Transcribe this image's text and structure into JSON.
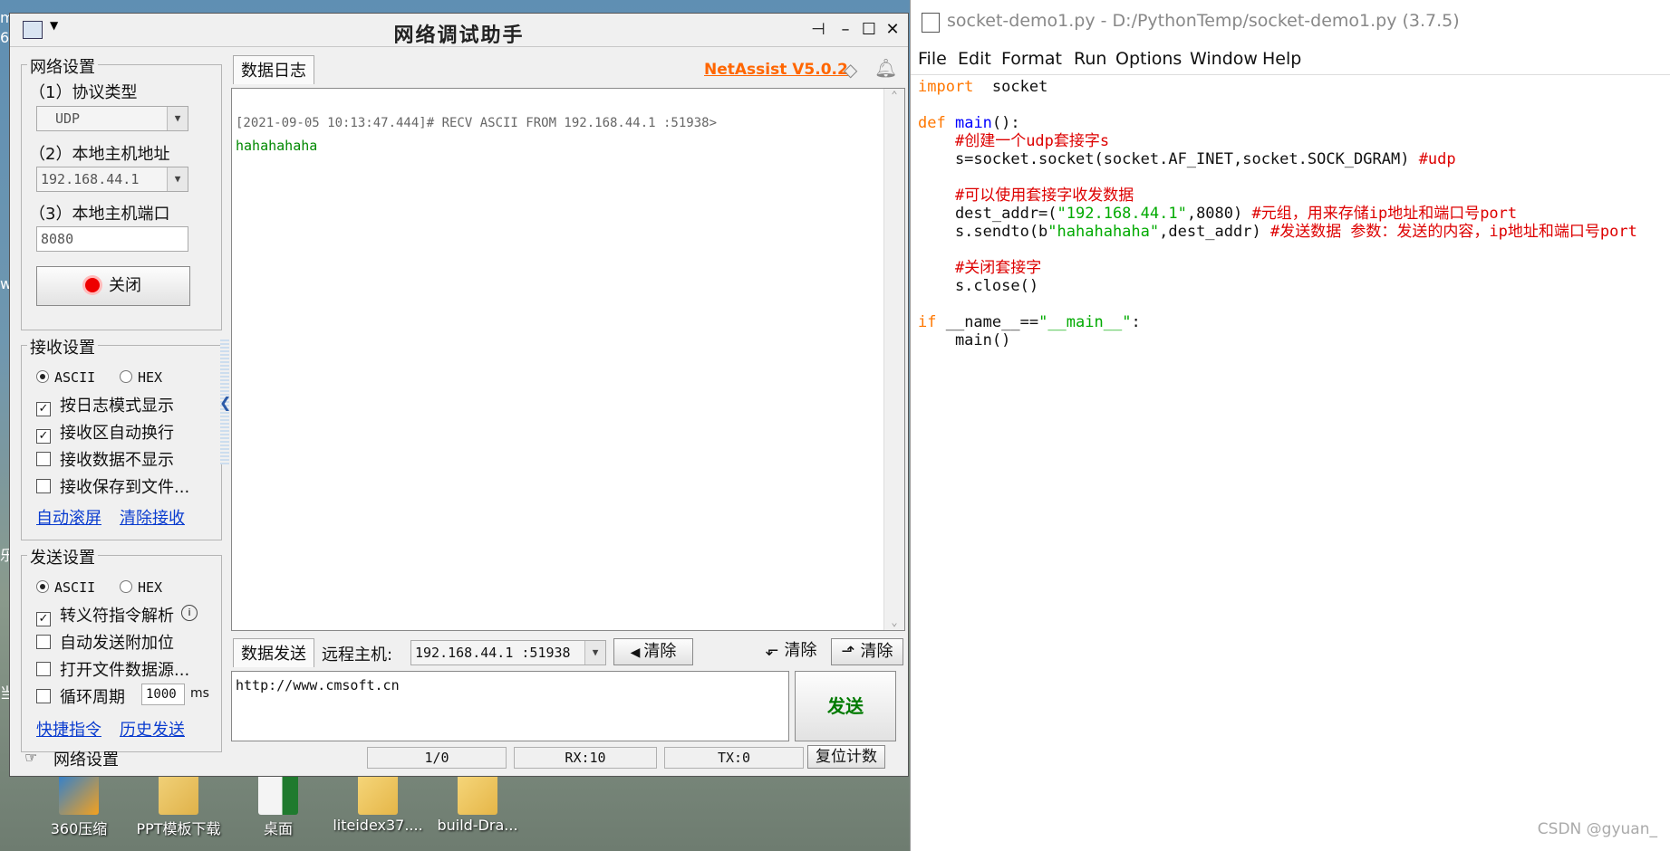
{
  "desktop": {
    "left_edge_texts": [
      "m",
      "6",
      "w",
      "乐",
      "当"
    ],
    "icons": [
      {
        "label": "360压缩"
      },
      {
        "label": "PPT模板下载"
      },
      {
        "label": "桌面"
      },
      {
        "label": "liteidex37...."
      },
      {
        "label": "build-Dra..."
      }
    ]
  },
  "netassist": {
    "title": "网络调试助手",
    "network_settings": {
      "title": "网络设置",
      "protocol_label": "（1）协议类型",
      "protocol_value": "UDP",
      "host_label": "（2）本地主机地址",
      "host_value": "192.168.44.1",
      "port_label": "（3）本地主机端口",
      "port_value": "8080",
      "close_button": "关闭"
    },
    "receive_settings": {
      "title": "接收设置",
      "ascii": "ASCII",
      "hex": "HEX",
      "log_mode": "按日志模式显示",
      "auto_wrap": "接收区自动换行",
      "no_display": "接收数据不显示",
      "save_to_file": "接收保存到文件...",
      "auto_scroll": "自动滚屏",
      "clear_receive": "清除接收"
    },
    "send_settings": {
      "title": "发送设置",
      "ascii": "ASCII",
      "hex": "HEX",
      "escape_parse": "转义符指令解析",
      "auto_append": "自动发送附加位",
      "open_file": "打开文件数据源...",
      "loop_label": "循环周期",
      "loop_value": "1000",
      "loop_unit": "ms",
      "shortcuts": "快捷指令",
      "history": "历史发送"
    },
    "log": {
      "tab": "数据日志",
      "brand": "NetAssist V5.0.2",
      "line1": "[2021-09-05 10:13:47.444]# RECV ASCII FROM 192.168.44.1 :51938>",
      "line2": "hahahahaha"
    },
    "send": {
      "tab": "数据发送",
      "remote_label": "远程主机:",
      "remote_value": "192.168.44.1 :51938",
      "clear1": "清除",
      "clear2": "清除",
      "clear3": "清除",
      "text": "http://www.cmsoft.cn",
      "send_button": "发送"
    },
    "status": {
      "label": "网络设置",
      "count": "1/0",
      "rx": "RX:10",
      "tx": "TX:0",
      "reset": "复位计数"
    },
    "colors": {
      "brand": "#ff6600",
      "received_text": "#008800",
      "send_button": "#007a00"
    }
  },
  "idle": {
    "title": "socket-demo1.py - D:/PythonTemp/socket-demo1.py (3.7.5)",
    "menu": [
      "File",
      "Edit",
      "Format",
      "Run",
      "Options",
      "Window",
      "Help"
    ],
    "watermark": "CSDN @gyuan_"
  }
}
